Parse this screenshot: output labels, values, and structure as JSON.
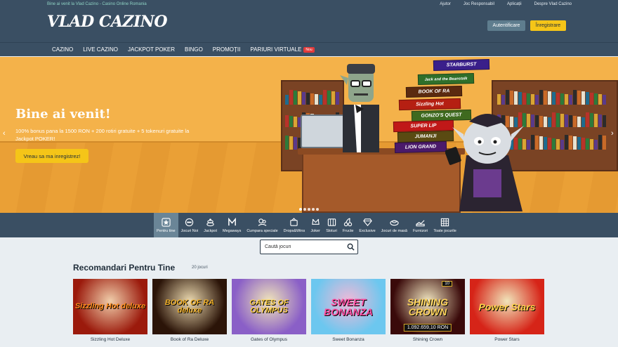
{
  "header": {
    "tagline": "Bine ai venit la Vlad Cazino - Casino Online Romania",
    "links": [
      "Ajutor",
      "Joc Responsabil",
      "Aplicații",
      "Despre Vlad Cazino"
    ],
    "logo": "VLAD CAZINO",
    "login_label": "Autentificare",
    "register_label": "Înregistrare"
  },
  "nav": {
    "items": [
      "CAZINO",
      "LIVE CAZINO",
      "JACKPOT POKER",
      "BINGO",
      "PROMOȚII",
      "PARIURI VIRTUALE"
    ],
    "new_badge": "Nou"
  },
  "hero": {
    "title": "Bine ai venit!",
    "text": "100% bonus pana la 1500 RON + 200 rotiri gratuite + 5 tokenuri gratuite la Jackpot POKER!",
    "cta": "Vreau sa ma inregistrez!",
    "prev_arrow": "‹",
    "next_arrow": "›",
    "stack_titles": [
      "STARBURST",
      "Jack and the Beanstalk",
      "BOOK OF RA",
      "Sizzling Hot",
      "GONZO'S QUEST",
      "SUPER LIP",
      "JUMANJI",
      "LION GRAND"
    ],
    "slides_total": 5,
    "slide_active": 1
  },
  "categories": [
    {
      "label": "Pentru tine",
      "icon": "star-icon",
      "active": true
    },
    {
      "label": "Jocuri Noi",
      "icon": "new-icon",
      "active": false
    },
    {
      "label": "Jackpot",
      "icon": "jackpot-icon",
      "active": false
    },
    {
      "label": "Megaways",
      "icon": "megaways-icon",
      "active": false
    },
    {
      "label": "Cumpara speciale",
      "icon": "bonus-buy-icon",
      "active": false
    },
    {
      "label": "Drops&Wins",
      "icon": "drops-icon",
      "active": false
    },
    {
      "label": "Joker",
      "icon": "joker-icon",
      "active": false
    },
    {
      "label": "Sloturi",
      "icon": "slots-icon",
      "active": false
    },
    {
      "label": "Fructe",
      "icon": "cherry-icon",
      "active": false
    },
    {
      "label": "Exclusive",
      "icon": "diamond-icon",
      "active": false
    },
    {
      "label": "Jocuri de masă",
      "icon": "table-games-icon",
      "active": false
    },
    {
      "label": "Furnizori",
      "icon": "providers-icon",
      "active": false
    },
    {
      "label": "Toate jocurile",
      "icon": "grid-icon",
      "active": false
    }
  ],
  "search": {
    "placeholder": "Caută jocuri"
  },
  "section": {
    "title": "Recomandari Pentru Tine",
    "count": "20 jocuri"
  },
  "games": [
    {
      "name": "Sizzling Hot Deluxe",
      "art": "Sizzling Hot deluxe",
      "bg": "#9b1a0c",
      "fg": "#ff8c1a"
    },
    {
      "name": "Book of Ra Deluxe",
      "art": "BOOK OF RA deluxe",
      "bg": "#2b1408",
      "fg": "#f0b02a"
    },
    {
      "name": "Gates of Olympus",
      "art": "GATES OF OLYMPUS",
      "bg": "#8a5fc7",
      "fg": "#ffd24a"
    },
    {
      "name": "Sweet Bonanza",
      "art": "SWEET BONANZA",
      "bg": "#6cc7ef",
      "fg": "#ff4fa3"
    },
    {
      "name": "Shining Crown",
      "art": "SHINING CROWN",
      "bg": "#3a0a0a",
      "fg": "#ffd45a",
      "jackpot": "1.092.659,10 RON",
      "lines": "10"
    },
    {
      "name": "Power Stars",
      "art": "Power Stars",
      "bg": "#d62418",
      "fg": "#ffd24a"
    }
  ]
}
